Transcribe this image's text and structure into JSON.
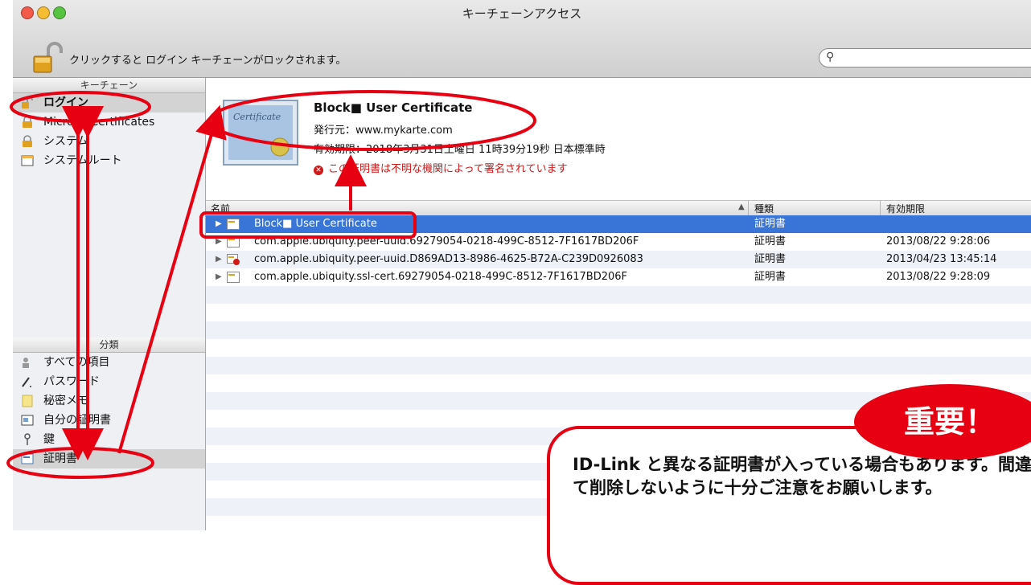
{
  "window": {
    "title": "キーチェーンアクセス"
  },
  "toolbar": {
    "lock_message": "クリックすると ログイン キーチェーンがロックされます。",
    "search_placeholder": ""
  },
  "sidebar": {
    "keychains_header": "キーチェーン",
    "keychains": [
      {
        "label": "ログイン",
        "icon": "unlocked-padlock-icon",
        "selected": true
      },
      {
        "label": "Micros...Certificates",
        "icon": "padlock-icon"
      },
      {
        "label": "システム",
        "icon": "padlock-icon"
      },
      {
        "label": "システムルート",
        "icon": "cabinet-icon"
      }
    ],
    "category_header": "分類",
    "categories": [
      {
        "label": "すべての項目",
        "icon": "people-icon"
      },
      {
        "label": "パスワード",
        "icon": "pencil-icon"
      },
      {
        "label": "秘密メモ",
        "icon": "note-icon"
      },
      {
        "label": "自分の証明書",
        "icon": "cert-person-icon"
      },
      {
        "label": "鍵",
        "icon": "key-icon"
      },
      {
        "label": "証明書",
        "icon": "certificate-icon",
        "selected": true
      }
    ]
  },
  "detail": {
    "name": "Block■ User Certificate",
    "issuer": "発行元：www.mykarte.com",
    "expires": "有効期限：2018年3月31日土曜日 11時39分19秒 日本標準時",
    "warning": "この証明書は不明な機関によって署名されています",
    "cert_image_text": "Certificate"
  },
  "table": {
    "columns": {
      "name": "名前",
      "kind": "種類",
      "expires": "有効期限"
    },
    "rows": [
      {
        "name": "Block■ User Certificate",
        "kind": "証明書",
        "date": "",
        "selected": true
      },
      {
        "name": "com.apple.ubiquity.peer-uuid.69279054-0218-499C-8512-7F1617BD206F",
        "kind": "証明書",
        "date": "2013/08/22 9:28:06"
      },
      {
        "name": "com.apple.ubiquity.peer-uuid.D869AD13-8986-4625-B72A-C239D0926083",
        "kind": "証明書",
        "date": "2013/04/23 13:45:14",
        "error": true
      },
      {
        "name": "com.apple.ubiquity.ssl-cert.69279054-0218-499C-8512-7F1617BD206F",
        "kind": "証明書",
        "date": "2013/08/22 9:28:09"
      }
    ]
  },
  "annotation": {
    "badge": "重要！",
    "note": "ID-Link と異なる証明書が入っている場合もあります。間違って削除しないように十分ご注意をお願いします。",
    "color": "#e60012"
  },
  "colors": {
    "selection": "#3875d7",
    "warning": "#d31818"
  }
}
